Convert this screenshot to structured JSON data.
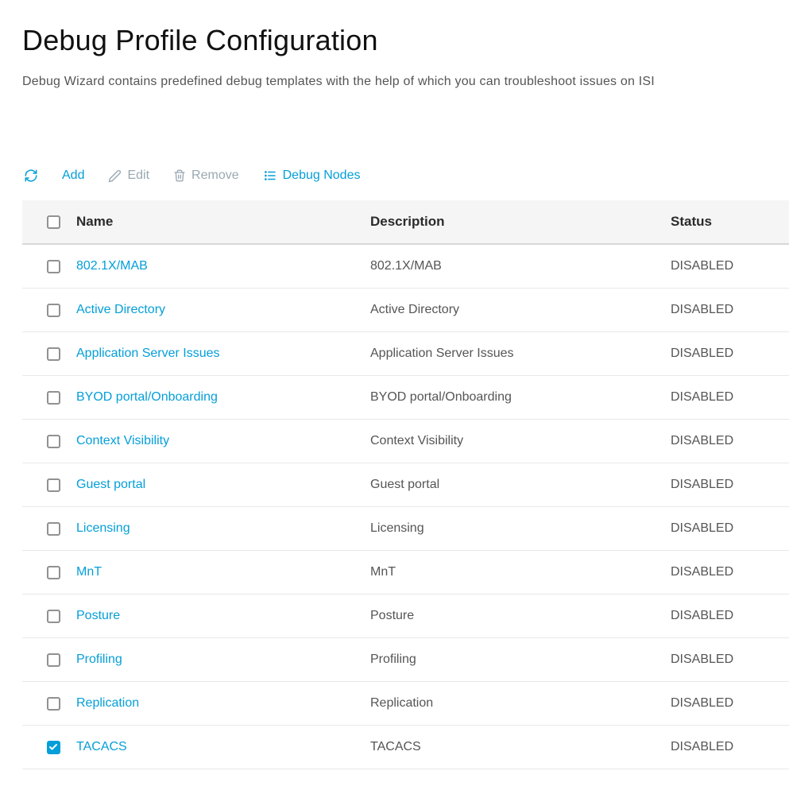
{
  "page": {
    "title": "Debug Profile Configuration",
    "subtitle": "Debug Wizard contains predefined debug templates with the help of which you can troubleshoot issues on ISI"
  },
  "toolbar": {
    "add_label": "Add",
    "edit_label": "Edit",
    "remove_label": "Remove",
    "debug_nodes_label": "Debug Nodes"
  },
  "table": {
    "headers": {
      "name": "Name",
      "description": "Description",
      "status": "Status"
    },
    "rows": [
      {
        "name": "802.1X/MAB",
        "description": "802.1X/MAB",
        "status": "DISABLED",
        "checked": false
      },
      {
        "name": "Active Directory",
        "description": "Active Directory",
        "status": "DISABLED",
        "checked": false
      },
      {
        "name": "Application Server Issues",
        "description": "Application Server Issues",
        "status": "DISABLED",
        "checked": false
      },
      {
        "name": "BYOD portal/Onboarding",
        "description": "BYOD portal/Onboarding",
        "status": "DISABLED",
        "checked": false
      },
      {
        "name": "Context Visibility",
        "description": "Context Visibility",
        "status": "DISABLED",
        "checked": false
      },
      {
        "name": "Guest portal",
        "description": "Guest portal",
        "status": "DISABLED",
        "checked": false
      },
      {
        "name": "Licensing",
        "description": "Licensing",
        "status": "DISABLED",
        "checked": false
      },
      {
        "name": "MnT",
        "description": "MnT",
        "status": "DISABLED",
        "checked": false
      },
      {
        "name": "Posture",
        "description": "Posture",
        "status": "DISABLED",
        "checked": false
      },
      {
        "name": "Profiling",
        "description": "Profiling",
        "status": "DISABLED",
        "checked": false
      },
      {
        "name": "Replication",
        "description": "Replication",
        "status": "DISABLED",
        "checked": false
      },
      {
        "name": "TACACS",
        "description": "TACACS",
        "status": "DISABLED",
        "checked": true
      }
    ]
  }
}
